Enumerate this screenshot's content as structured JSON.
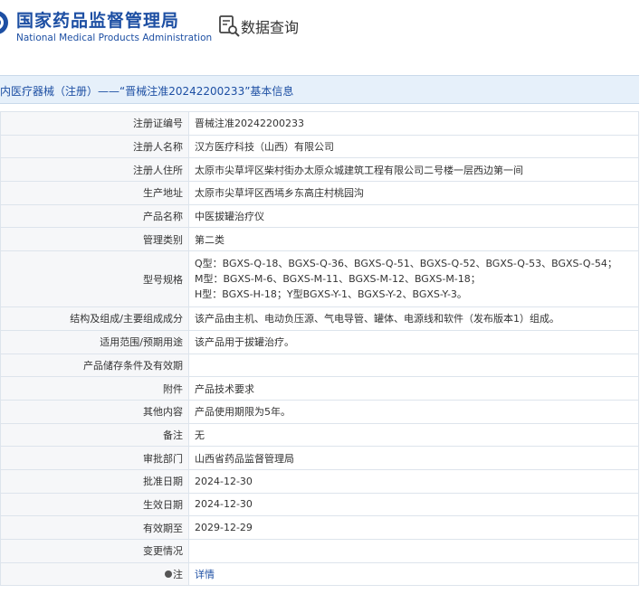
{
  "header": {
    "org_cn": "国家药品监督管理局",
    "org_en": "National Medical Products Administration",
    "query_label": "数据查询",
    "brand_color": "#1d4fa3"
  },
  "page_title": "内医疗器械（注册）——“晋械注准20242200233”基本信息",
  "rows": [
    {
      "label": "注册证编号",
      "value": "晋械注准20242200233"
    },
    {
      "label": "注册人名称",
      "value": "汉方医疗科技（山西）有限公司"
    },
    {
      "label": "注册人住所",
      "value": "太原市尖草坪区柴村街办太原众城建筑工程有限公司二号楼一层西边第一间"
    },
    {
      "label": "生产地址",
      "value": "太原市尖草坪区西墕乡东高庄村桃园沟"
    },
    {
      "label": "产品名称",
      "value": "中医拔罐治疗仪"
    },
    {
      "label": "管理类别",
      "value": "第二类"
    },
    {
      "label": "型号规格",
      "lines": [
        "Q型：BGXS-Q-18、BGXS-Q-36、BGXS-Q-51、BGXS-Q-52、BGXS-Q-53、BGXS-Q-54；",
        "M型：BGXS-M-6、BGXS-M-11、BGXS-M-12、BGXS-M-18；",
        "H型：BGXS-H-18；Y型BGXS-Y-1、BGXS-Y-2、BGXS-Y-3。"
      ]
    },
    {
      "label": "结构及组成/主要组成成分",
      "value": "该产品由主机、电动负压源、气电导管、罐体、电源线和软件（发布版本1）组成。"
    },
    {
      "label": "适用范围/预期用途",
      "value": "该产品用于拔罐治疗。"
    },
    {
      "label": "产品储存条件及有效期",
      "value": ""
    },
    {
      "label": "附件",
      "value": "产品技术要求"
    },
    {
      "label": "其他内容",
      "value": "产品使用期限为5年。"
    },
    {
      "label": "备注",
      "value": "无"
    },
    {
      "label": "审批部门",
      "value": "山西省药品监督管理局"
    },
    {
      "label": "批准日期",
      "value": "2024-12-30"
    },
    {
      "label": "生效日期",
      "value": "2024-12-30"
    },
    {
      "label": "有效期至",
      "value": "2029-12-29"
    },
    {
      "label": "变更情况",
      "value": ""
    },
    {
      "label": "注",
      "value": "详情"
    }
  ]
}
